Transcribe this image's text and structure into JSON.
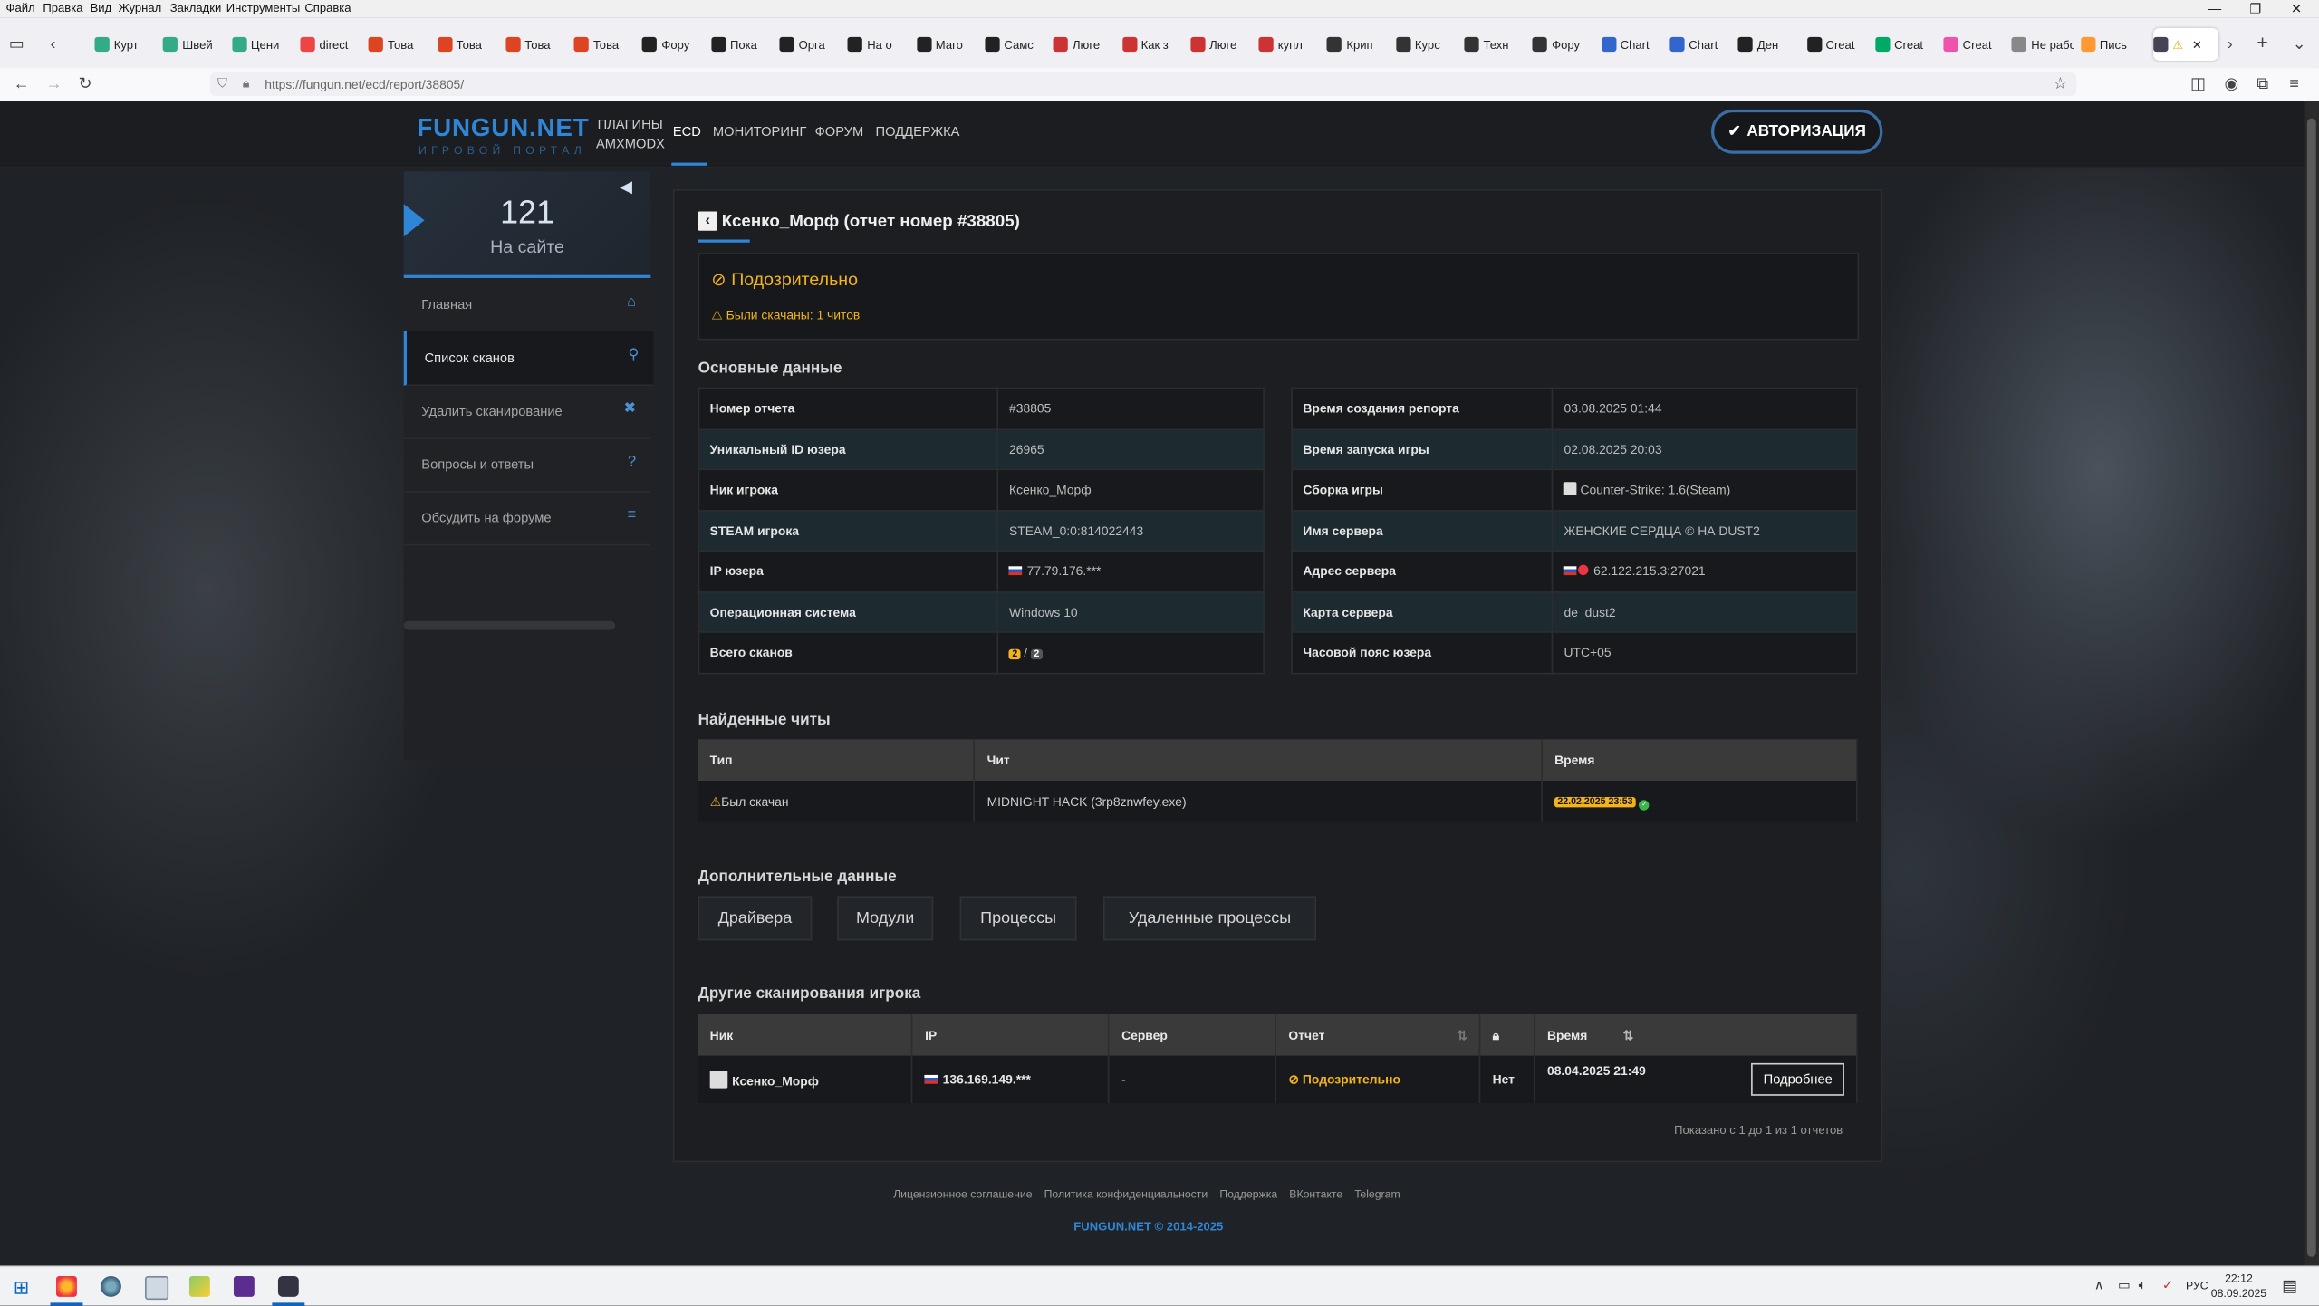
{
  "browser": {
    "menu": [
      "Файл",
      "Правка",
      "Вид",
      "Журнал",
      "Закладки",
      "Инструменты",
      "Справка"
    ],
    "tabs": [
      "Курт",
      "Швей",
      "Цени",
      "direct",
      "Това",
      "Това",
      "Това",
      "Това",
      "Фору",
      "Пока",
      "Орга",
      "На о",
      "Маго",
      "Самс",
      "Люге",
      "Как з",
      "Люге",
      "купл",
      "Крип",
      "Курс",
      "Техн",
      "Фору",
      "Chart",
      "Chart",
      "Ден",
      "Creat",
      "Creat",
      "Creat",
      "Не рабо",
      "Пись"
    ],
    "url": "https://fungun.net/ecd/report/38805/"
  },
  "site": {
    "logo_main": "FUNGUN.NET",
    "logo_sub": "ИГРОВОЙ ПОРТАЛ",
    "nav": {
      "plugins_line1": "ПЛАГИНЫ",
      "plugins_line2": "AMXMODX",
      "ecd": "ECD",
      "monitoring": "МОНИТОРИНГ",
      "forum": "ФОРУМ",
      "support": "ПОДДЕРЖКА",
      "auth": "АВТОРИЗАЦИЯ"
    },
    "sidebar": {
      "online_count": "121",
      "online_label": "На сайте",
      "items": [
        {
          "label": "Главная",
          "icon": "⌂"
        },
        {
          "label": "Список сканов",
          "icon": "⚲"
        },
        {
          "label": "Удалить сканирование",
          "icon": "✖"
        },
        {
          "label": "Вопросы и ответы",
          "icon": "?"
        },
        {
          "label": "Обсудить на форуме",
          "icon": "≡"
        }
      ]
    },
    "report": {
      "title": "Ксенко_Морф (отчет номер #38805)",
      "status": "Подозрительно",
      "status_note": "Были скачаны: 1 читов",
      "basic_heading": "Основные данные",
      "left": [
        {
          "k": "Номер отчета",
          "v": "#38805"
        },
        {
          "k": "Уникальный ID юзера",
          "v": "26965"
        },
        {
          "k": "Ник игрока",
          "v": "Ксенко_Морф"
        },
        {
          "k": "STEAM игрока",
          "v": "STEAM_0:0:814022443"
        },
        {
          "k": "IP юзера",
          "v": "77.79.176.***"
        },
        {
          "k": "Операционная система",
          "v": "Windows 10"
        },
        {
          "k": "Всего сканов",
          "v1": "2",
          "sep": "/",
          "v2": "2"
        }
      ],
      "right": [
        {
          "k": "Время создания репорта",
          "v": "03.08.2025 01:44"
        },
        {
          "k": "Время запуска игры",
          "v": "02.08.2025 20:03"
        },
        {
          "k": "Сборка игры",
          "v": "Counter-Strike: 1.6(Steam)"
        },
        {
          "k": "Имя сервера",
          "v": "ЖЕНСКИЕ СЕРДЦА © НА DUST2"
        },
        {
          "k": "Адрес сервера",
          "v": "62.122.215.3:27021"
        },
        {
          "k": "Карта сервера",
          "v": "de_dust2"
        },
        {
          "k": "Часовой пояс юзера",
          "v": "UTC+05"
        }
      ],
      "cheats_heading": "Найденные читы",
      "cheats_headers": [
        "Тип",
        "Чит",
        "Время"
      ],
      "cheats_rows": [
        {
          "type": "Был скачан",
          "cheat": "MIDNIGHT HACK (3rp8znwfey.exe)",
          "time": "22.02.2025 23:53"
        }
      ],
      "extra_heading": "Дополнительные данные",
      "extra_buttons": [
        "Драйвера",
        "Модули",
        "Процессы",
        "Удаленные процессы"
      ],
      "other_heading": "Другие сканирования игрока",
      "other_headers": [
        "Ник",
        "IP",
        "Сервер",
        "Отчет",
        "Время"
      ],
      "other_rows": [
        {
          "nick": "Ксенко_Морф",
          "ip": "136.169.149.***",
          "server": "-",
          "report": "Подозрительно",
          "locked": "Нет",
          "time": "08.04.2025 21:49",
          "more": "Подробнее"
        }
      ],
      "shown": "Показано с 1 до 1 из 1 отчетов"
    },
    "footer": {
      "links": [
        "Лицензионное соглашение",
        "Политика конфиденциальности",
        "Поддержка",
        "ВКонтакте",
        "Telegram"
      ],
      "copyright": "FUNGUN.NET © 2014-2025"
    }
  },
  "taskbar": {
    "lang": "РУС",
    "time": "22:12",
    "date": "08.09.2025"
  },
  "colors": {
    "accent": "#2f86d6",
    "warning": "#f2b31b",
    "ok": "#3cb54a"
  }
}
